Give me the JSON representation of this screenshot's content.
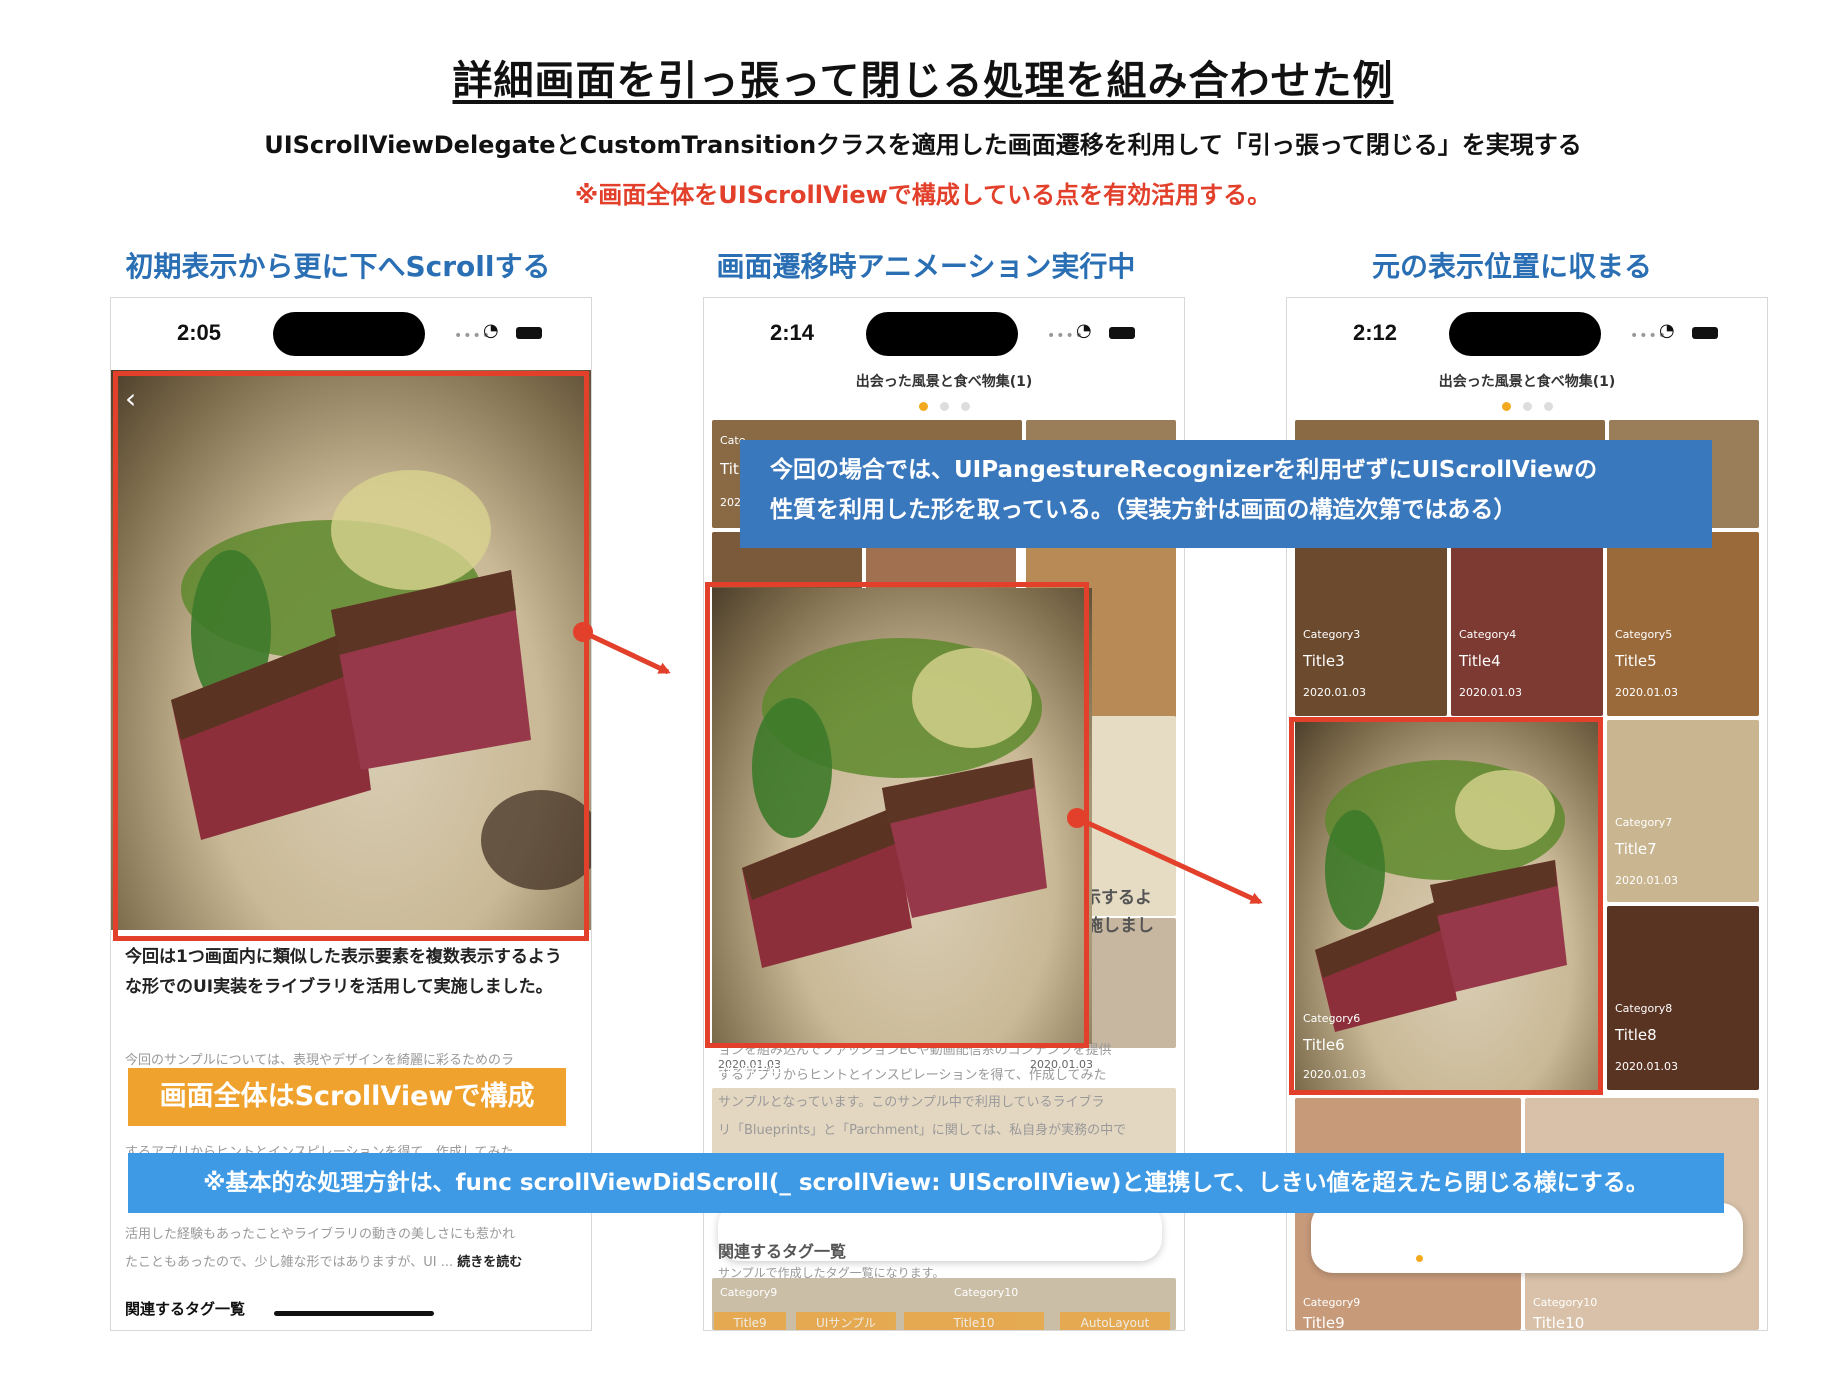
{
  "header": {
    "title": "詳細画面を引っ張って閉じる処理を組み合わせた例",
    "subtitle": "UIScrollViewDelegateとCustomTransitionクラスを適用した画面遷移を利用して「引っ張って閉じる」を実現する",
    "note": "※画面全体をUIScrollViewで構成している点を有効活用する。"
  },
  "columns": [
    {
      "heading": "初期表示から更に下へScrollする",
      "time": "2:05"
    },
    {
      "heading": "画面遷移時アニメーション実行中",
      "time": "2:14"
    },
    {
      "heading": "元の表示位置に収まる",
      "time": "2:12"
    }
  ],
  "phone1": {
    "back_icon": "chevron-left-icon",
    "body_text": "今回は1つ画面内に類似した表示要素を複数表示するような形でのUI実装をライブラリを活用して実施しました。",
    "gray_line1": "今回のサンプルについては、表現やデザインを綺麗に彩るためのラ",
    "gray_line2": "するアプリからヒントとインスピレーションを得て、作成してみた",
    "gray_line3": "活用した経験もあったことやライブラリの動きの美しさにも惹かれ",
    "gray_line4": "たこともあったので、少し雑な形ではありますが、UI ...",
    "read_more": "続きを読む",
    "tags_heading": "関連するタグ一覧"
  },
  "phone2": {
    "screen_title": "出会った風景と食べ物集(1)",
    "cat_peek": "Cate",
    "title_peek": "Title",
    "date_peek": "2020",
    "partial_text1": "示するよ",
    "partial_text2": "施しまし",
    "gray_line1": "ョンを組み込んでファッションECや動画配信系のコンテンツを提供",
    "gray_line2": "するアプリからヒントとインスピレーションを得て、作成してみた",
    "gray_line3": "サンプルとなっています。このサンプル中で利用しているライブラ",
    "gray_line4": "リ「Blueprints」と「Parchment」に関しては、私自身が実務の中で",
    "date_under": "2020.01.03",
    "date_under2": "2020.01.03",
    "tags_heading": "関連するタグ一覧",
    "tags_sub": "サンプルで作成したタグ一覧になります。",
    "cat9": "Category9",
    "cat10": "Category10",
    "title9": "Title9",
    "title10": "Title10",
    "chip1": "UIサンプル",
    "chip2": "AutoLayout"
  },
  "phone3": {
    "screen_title": "出会った風景と食べ物集(1)",
    "tiles": [
      {
        "cat": "Category3",
        "title": "Title3",
        "date": "2020.01.03"
      },
      {
        "cat": "Category4",
        "title": "Title4",
        "date": "2020.01.03"
      },
      {
        "cat": "Category5",
        "title": "Title5",
        "date": "2020.01.03"
      },
      {
        "cat": "Category6",
        "title": "Title6",
        "date": "2020.01.03"
      },
      {
        "cat": "Category7",
        "title": "Title7",
        "date": "2020.01.03"
      },
      {
        "cat": "Category8",
        "title": "Title8",
        "date": "2020.01.03"
      },
      {
        "cat": "Category9",
        "title": "Title9",
        "date": ""
      },
      {
        "cat": "Category10",
        "title": "Title10",
        "date": ""
      }
    ]
  },
  "callouts": {
    "orange": "画面全体はScrollViewで構成",
    "blue_line1": "今回の場合では、UIPangestureRecognizerを利用ぜずにUIScrollViewの",
    "blue_line2": "性質を利用した形を取っている。（実装方針は画面の構造次第ではある）",
    "bottom": "※基本的な処理方針は、func scrollViewDidScroll(_ scrollView: UIScrollView)と連携して、しきい値を超えたら閉じる様にする。"
  },
  "colors": {
    "accent_red": "#e2402b",
    "heading_blue": "#2a6fb4",
    "callout_blue": "#3a78bd",
    "bottom_blue": "#3f9ae6",
    "orange": "#f0a22e",
    "page_dot_active": "#f2a91e"
  }
}
